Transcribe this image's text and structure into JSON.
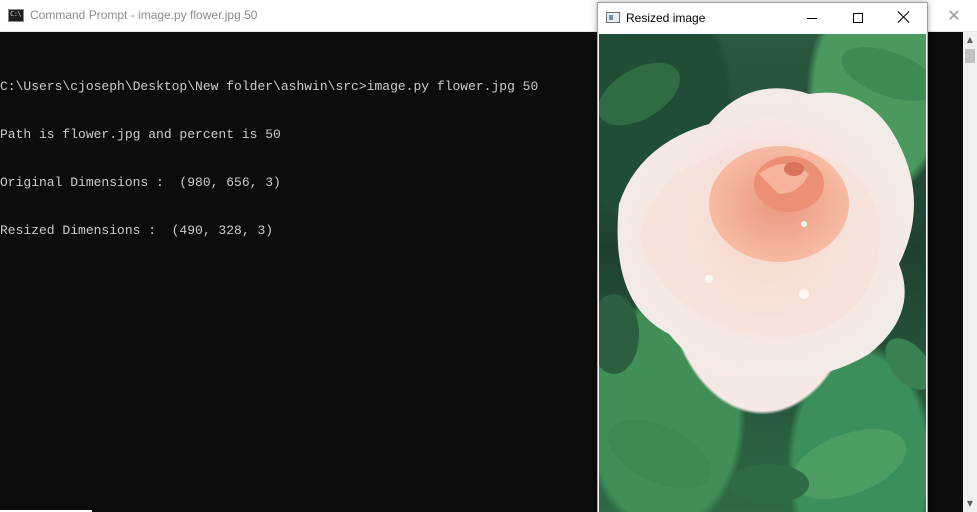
{
  "cmd_window": {
    "title": "Command Prompt - image.py  flower.jpg 50",
    "icon": "console-icon",
    "icon_glyph": "C:\\",
    "close_glyph": "✕",
    "lines": [
      "C:\\Users\\cjoseph\\Desktop\\New folder\\ashwin\\src>image.py flower.jpg 50",
      "Path is flower.jpg and percent is 50",
      "Original Dimensions :  (980, 656, 3)",
      "Resized Dimensions :  (490, 328, 3)"
    ],
    "scroll_up_glyph": "▲",
    "scroll_down_glyph": "▼"
  },
  "image_window": {
    "title": "Resized image",
    "content": "flower-image",
    "colors": {
      "petal": "#f6e8e2",
      "petal_center": "#f3a98a",
      "leaf": "#2e6a45"
    }
  }
}
